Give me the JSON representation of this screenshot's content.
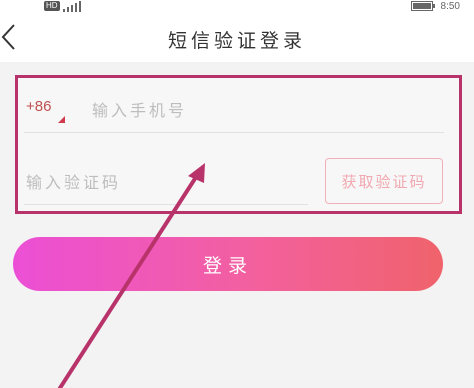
{
  "status_bar": {
    "network_badge": "HD",
    "time": "8:50"
  },
  "header": {
    "title": "短信验证登录"
  },
  "form": {
    "country_code": "+86",
    "phone_placeholder": "输入手机号",
    "code_placeholder": "输入验证码",
    "get_code_label": "获取验证码"
  },
  "login_button": {
    "label": "登录"
  },
  "colors": {
    "annotation": "#b8336a",
    "accent": "#d03a4a",
    "button_gradient_start": "#ec4fd6",
    "button_gradient_end": "#f0636b"
  },
  "icons": {
    "back": "back-chevron-icon",
    "signal": "signal-icon",
    "battery": "battery-icon"
  }
}
